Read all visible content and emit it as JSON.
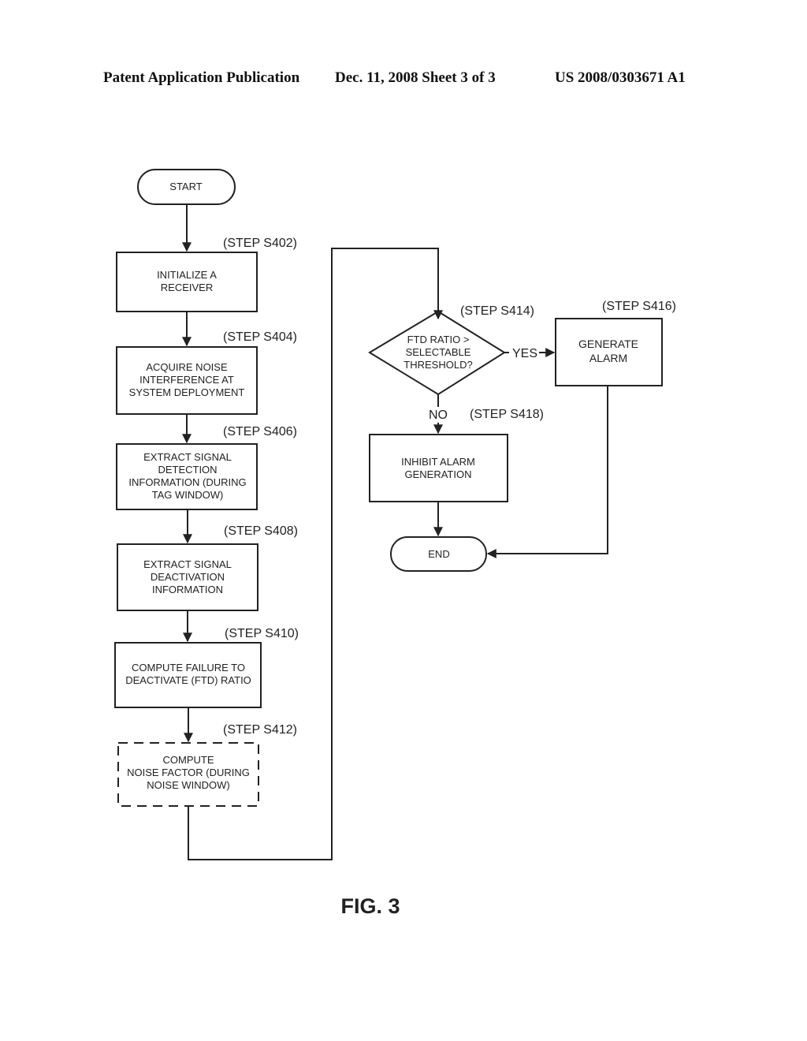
{
  "header": {
    "publication": "Patent Application Publication",
    "date_sheet": "Dec. 11, 2008   Sheet 3 of 3",
    "number": "US 2008/0303671 A1"
  },
  "nodes": {
    "start": {
      "label": "START"
    },
    "s402": {
      "step": "(STEP S402)",
      "lines": [
        "INITIALIZE A",
        "RECEIVER"
      ]
    },
    "s404": {
      "step": "(STEP S404)",
      "lines": [
        "ACQUIRE NOISE",
        "INTERFERENCE AT",
        "SYSTEM DEPLOYMENT"
      ]
    },
    "s406": {
      "step": "(STEP S406)",
      "lines": [
        "EXTRACT SIGNAL",
        "DETECTION",
        "INFORMATION (DURING",
        "TAG WINDOW)"
      ]
    },
    "s408": {
      "step": "(STEP S408)",
      "lines": [
        "EXTRACT SIGNAL",
        "DEACTIVATION",
        "INFORMATION"
      ]
    },
    "s410": {
      "step": "(STEP S410)",
      "lines": [
        "COMPUTE FAILURE TO",
        "DEACTIVATE (FTD) RATIO"
      ]
    },
    "s412": {
      "step": "(STEP S412)",
      "lines": [
        "COMPUTE",
        "NOISE FACTOR (DURING",
        "NOISE WINDOW)"
      ]
    },
    "s414": {
      "step": "(STEP S414)",
      "lines": [
        "FTD RATIO >",
        "SELECTABLE",
        "THRESHOLD?"
      ]
    },
    "s416": {
      "step": "(STEP S416)",
      "lines": [
        "GENERATE",
        "ALARM"
      ]
    },
    "s418": {
      "step": "(STEP S418)",
      "lines": [
        "INHIBIT ALARM",
        "GENERATION"
      ]
    },
    "end": {
      "label": "END"
    }
  },
  "edges": {
    "yes": "YES",
    "no": "NO"
  },
  "figure_label": "FIG. 3"
}
